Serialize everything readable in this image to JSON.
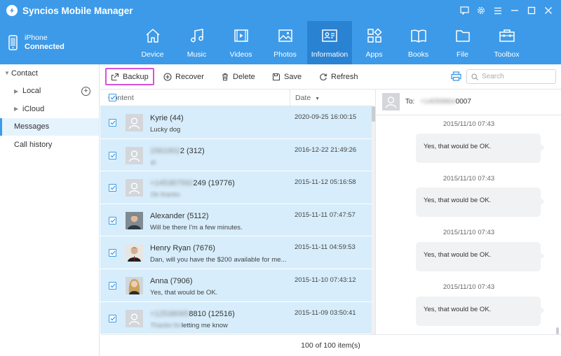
{
  "app": {
    "title": "Syncios Mobile Manager"
  },
  "device": {
    "name": "iPhone",
    "status": "Connected"
  },
  "nav": {
    "tabs": [
      {
        "label": "Device",
        "icon": "home-icon"
      },
      {
        "label": "Music",
        "icon": "music-icon"
      },
      {
        "label": "Videos",
        "icon": "video-icon"
      },
      {
        "label": "Photos",
        "icon": "photo-icon"
      },
      {
        "label": "Information",
        "icon": "contact-card-icon",
        "active": true
      },
      {
        "label": "Apps",
        "icon": "apps-icon"
      },
      {
        "label": "Books",
        "icon": "book-icon"
      },
      {
        "label": "File",
        "icon": "folder-icon"
      },
      {
        "label": "Toolbox",
        "icon": "toolbox-icon"
      }
    ]
  },
  "sidebar": {
    "contact": "Contact",
    "local": "Local",
    "icloud": "iCloud",
    "messages": "Messages",
    "call_history": "Call history"
  },
  "toolbar": {
    "backup": "Backup",
    "recover": "Recover",
    "delete": "Delete",
    "save": "Save",
    "refresh": "Refresh",
    "search_placeholder": "Search"
  },
  "list": {
    "col_content": "Content",
    "col_date": "Date",
    "rows": [
      {
        "name": "Kyrie (44)",
        "name_hidden": "",
        "preview": "Lucky dog",
        "preview_hidden": "",
        "date": "2020-09-25 16:00:15",
        "photo": false
      },
      {
        "name": "2 (312)",
        "name_hidden": "1561902",
        "preview": "",
        "preview_hidden": "at",
        "date": "2016-12-22 21:49:26",
        "photo": false
      },
      {
        "name": "249 (19776)",
        "name_hidden": "+145387592",
        "preview": "",
        "preview_hidden": "Ok thanks",
        "date": "2015-11-12 05:16:58",
        "photo": false
      },
      {
        "name": "Alexander (5112)",
        "name_hidden": "",
        "preview": "Will be there I'm a few minutes.",
        "preview_hidden": "",
        "date": "2015-11-11 07:47:57",
        "photo": true
      },
      {
        "name": "Henry Ryan (7676)",
        "name_hidden": "",
        "preview": "Dan, will you have the $200 available for me...",
        "preview_hidden": "",
        "date": "2015-11-11 04:59:53",
        "photo": true
      },
      {
        "name": "Anna (7906)",
        "name_hidden": "",
        "preview": "Yes, that would be OK.",
        "preview_hidden": "",
        "date": "2015-11-10 07:43:12",
        "photo": true
      },
      {
        "name": "8810 (12516)",
        "name_hidden": "+12538065",
        "preview": "letting me know",
        "preview_hidden": "Thanks for",
        "date": "2015-11-09 03:50:41",
        "photo": false
      }
    ]
  },
  "detail": {
    "to_label": "To:",
    "to_hidden": "+14059864",
    "to_number": "0007",
    "messages": [
      {
        "time": "2015/11/10 07:43",
        "text": "Yes, that would be OK."
      },
      {
        "time": "2015/11/10 07:43",
        "text": "Yes, that would be OK."
      },
      {
        "time": "2015/11/10 07:43",
        "text": "Yes, that would be OK."
      },
      {
        "time": "2015/11/10 07:43",
        "text": "Yes, that would be OK."
      }
    ]
  },
  "status": {
    "count_text": "100 of 100 item(s)"
  },
  "colors": {
    "accent": "#3d9ae8",
    "active_tab": "#2a82d3",
    "row_selected": "#d7edfb",
    "highlight_border": "#d552d7"
  }
}
